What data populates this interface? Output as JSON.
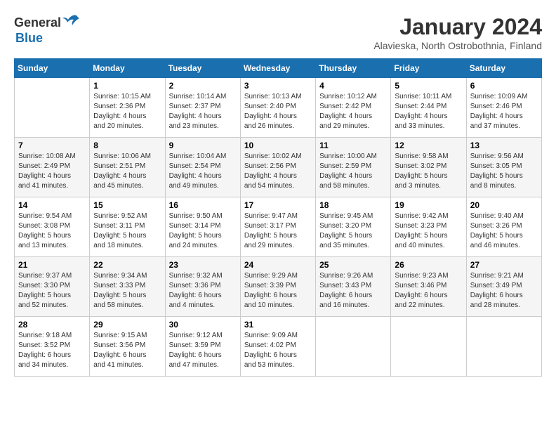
{
  "header": {
    "logo": {
      "general": "General",
      "blue": "Blue"
    },
    "title": "January 2024",
    "location": "Alavieska, North Ostrobothnia, Finland"
  },
  "calendar": {
    "days_of_week": [
      "Sunday",
      "Monday",
      "Tuesday",
      "Wednesday",
      "Thursday",
      "Friday",
      "Saturday"
    ],
    "weeks": [
      [
        {
          "day": "",
          "info": ""
        },
        {
          "day": "1",
          "info": "Sunrise: 10:15 AM\nSunset: 2:36 PM\nDaylight: 4 hours\nand 20 minutes."
        },
        {
          "day": "2",
          "info": "Sunrise: 10:14 AM\nSunset: 2:37 PM\nDaylight: 4 hours\nand 23 minutes."
        },
        {
          "day": "3",
          "info": "Sunrise: 10:13 AM\nSunset: 2:40 PM\nDaylight: 4 hours\nand 26 minutes."
        },
        {
          "day": "4",
          "info": "Sunrise: 10:12 AM\nSunset: 2:42 PM\nDaylight: 4 hours\nand 29 minutes."
        },
        {
          "day": "5",
          "info": "Sunrise: 10:11 AM\nSunset: 2:44 PM\nDaylight: 4 hours\nand 33 minutes."
        },
        {
          "day": "6",
          "info": "Sunrise: 10:09 AM\nSunset: 2:46 PM\nDaylight: 4 hours\nand 37 minutes."
        }
      ],
      [
        {
          "day": "7",
          "info": "Sunrise: 10:08 AM\nSunset: 2:49 PM\nDaylight: 4 hours\nand 41 minutes."
        },
        {
          "day": "8",
          "info": "Sunrise: 10:06 AM\nSunset: 2:51 PM\nDaylight: 4 hours\nand 45 minutes."
        },
        {
          "day": "9",
          "info": "Sunrise: 10:04 AM\nSunset: 2:54 PM\nDaylight: 4 hours\nand 49 minutes."
        },
        {
          "day": "10",
          "info": "Sunrise: 10:02 AM\nSunset: 2:56 PM\nDaylight: 4 hours\nand 54 minutes."
        },
        {
          "day": "11",
          "info": "Sunrise: 10:00 AM\nSunset: 2:59 PM\nDaylight: 4 hours\nand 58 minutes."
        },
        {
          "day": "12",
          "info": "Sunrise: 9:58 AM\nSunset: 3:02 PM\nDaylight: 5 hours\nand 3 minutes."
        },
        {
          "day": "13",
          "info": "Sunrise: 9:56 AM\nSunset: 3:05 PM\nDaylight: 5 hours\nand 8 minutes."
        }
      ],
      [
        {
          "day": "14",
          "info": "Sunrise: 9:54 AM\nSunset: 3:08 PM\nDaylight: 5 hours\nand 13 minutes."
        },
        {
          "day": "15",
          "info": "Sunrise: 9:52 AM\nSunset: 3:11 PM\nDaylight: 5 hours\nand 18 minutes."
        },
        {
          "day": "16",
          "info": "Sunrise: 9:50 AM\nSunset: 3:14 PM\nDaylight: 5 hours\nand 24 minutes."
        },
        {
          "day": "17",
          "info": "Sunrise: 9:47 AM\nSunset: 3:17 PM\nDaylight: 5 hours\nand 29 minutes."
        },
        {
          "day": "18",
          "info": "Sunrise: 9:45 AM\nSunset: 3:20 PM\nDaylight: 5 hours\nand 35 minutes."
        },
        {
          "day": "19",
          "info": "Sunrise: 9:42 AM\nSunset: 3:23 PM\nDaylight: 5 hours\nand 40 minutes."
        },
        {
          "day": "20",
          "info": "Sunrise: 9:40 AM\nSunset: 3:26 PM\nDaylight: 5 hours\nand 46 minutes."
        }
      ],
      [
        {
          "day": "21",
          "info": "Sunrise: 9:37 AM\nSunset: 3:30 PM\nDaylight: 5 hours\nand 52 minutes."
        },
        {
          "day": "22",
          "info": "Sunrise: 9:34 AM\nSunset: 3:33 PM\nDaylight: 5 hours\nand 58 minutes."
        },
        {
          "day": "23",
          "info": "Sunrise: 9:32 AM\nSunset: 3:36 PM\nDaylight: 6 hours\nand 4 minutes."
        },
        {
          "day": "24",
          "info": "Sunrise: 9:29 AM\nSunset: 3:39 PM\nDaylight: 6 hours\nand 10 minutes."
        },
        {
          "day": "25",
          "info": "Sunrise: 9:26 AM\nSunset: 3:43 PM\nDaylight: 6 hours\nand 16 minutes."
        },
        {
          "day": "26",
          "info": "Sunrise: 9:23 AM\nSunset: 3:46 PM\nDaylight: 6 hours\nand 22 minutes."
        },
        {
          "day": "27",
          "info": "Sunrise: 9:21 AM\nSunset: 3:49 PM\nDaylight: 6 hours\nand 28 minutes."
        }
      ],
      [
        {
          "day": "28",
          "info": "Sunrise: 9:18 AM\nSunset: 3:52 PM\nDaylight: 6 hours\nand 34 minutes."
        },
        {
          "day": "29",
          "info": "Sunrise: 9:15 AM\nSunset: 3:56 PM\nDaylight: 6 hours\nand 41 minutes."
        },
        {
          "day": "30",
          "info": "Sunrise: 9:12 AM\nSunset: 3:59 PM\nDaylight: 6 hours\nand 47 minutes."
        },
        {
          "day": "31",
          "info": "Sunrise: 9:09 AM\nSunset: 4:02 PM\nDaylight: 6 hours\nand 53 minutes."
        },
        {
          "day": "",
          "info": ""
        },
        {
          "day": "",
          "info": ""
        },
        {
          "day": "",
          "info": ""
        }
      ]
    ]
  }
}
